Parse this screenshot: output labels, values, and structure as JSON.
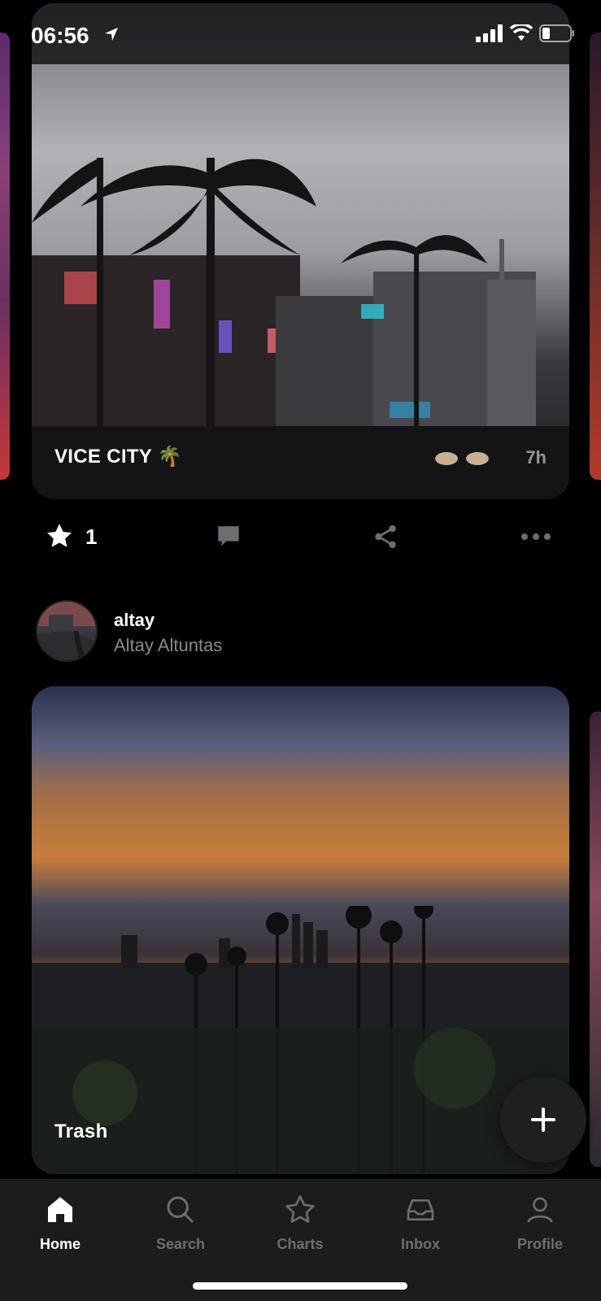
{
  "status_bar": {
    "time": "06:56",
    "icons": [
      "location-arrow-icon",
      "cellular-signal-icon",
      "wifi-icon",
      "battery-icon"
    ]
  },
  "feed": {
    "posts": [
      {
        "title": "VICE CITY 🌴",
        "age": "7h",
        "actions": {
          "star_count": "1",
          "icons": [
            "star-icon",
            "comment-icon",
            "share-icon",
            "more-icon"
          ]
        }
      },
      {
        "author_username": "altay",
        "author_full_name": "Altay Altuntas",
        "title": "Trash"
      }
    ]
  },
  "fab": {
    "icon": "plus-icon"
  },
  "tab_bar": {
    "items": [
      {
        "label": "Home",
        "icon": "home-icon",
        "active": true
      },
      {
        "label": "Search",
        "icon": "search-icon",
        "active": false
      },
      {
        "label": "Charts",
        "icon": "star-outline-icon",
        "active": false
      },
      {
        "label": "Inbox",
        "icon": "inbox-icon",
        "active": false
      },
      {
        "label": "Profile",
        "icon": "profile-icon",
        "active": false
      }
    ]
  },
  "colors": {
    "background": "#000000",
    "tab_bar": "#1c1c1e",
    "inactive_tab": "#6d6d72",
    "secondary_text": "#8a8a8e"
  }
}
